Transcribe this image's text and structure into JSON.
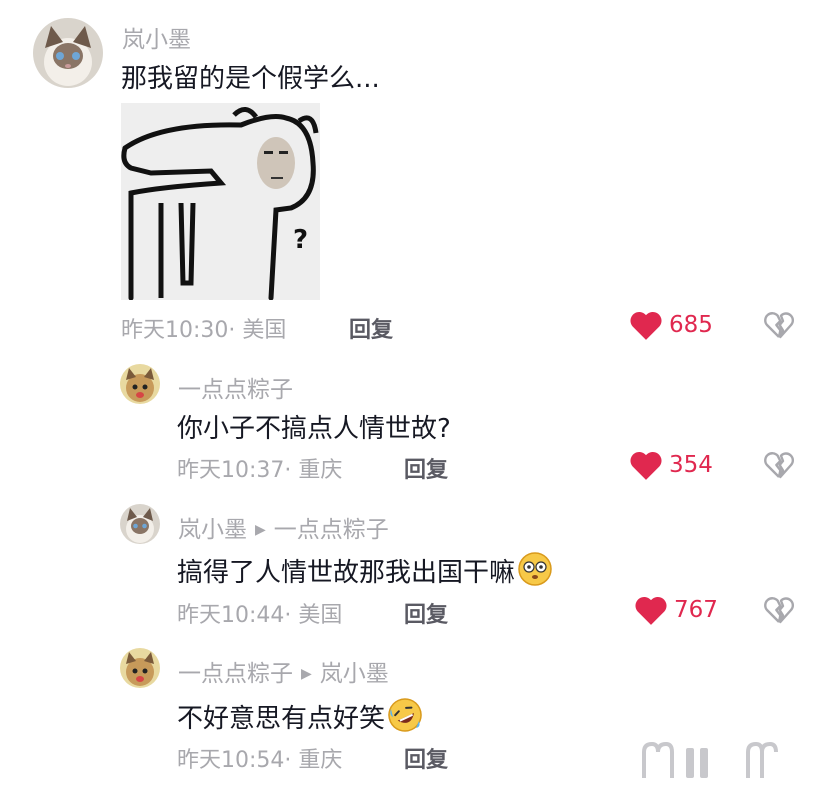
{
  "comments": [
    {
      "username": "岚小墨",
      "text": "那我留的是个假学么...",
      "time": "昨天10:30",
      "location": "· 美国",
      "reply_label": "回复",
      "likes": "685",
      "avatar": "cat-avatar"
    },
    {
      "username": "一点点粽子",
      "text": "你小子不搞点人情世故?",
      "time": "昨天10:37",
      "location": "· 重庆",
      "reply_label": "回复",
      "likes": "354",
      "avatar": "cat-avatar-2"
    },
    {
      "username": "岚小墨",
      "reply_to": "一点点粽子",
      "text": "搞得了人情世故那我出国干嘛",
      "emoji": "flushed-face",
      "time": "昨天10:44",
      "location": "· 美国",
      "reply_label": "回复",
      "likes": "767",
      "avatar": "cat-avatar"
    },
    {
      "username": "一点点粽子",
      "reply_to": "岚小墨",
      "text": "不好意思有点好笑",
      "emoji": "rolling-laughing-face",
      "time": "昨天10:54",
      "location": "· 重庆",
      "reply_label": "回复",
      "avatar": "cat-avatar-2"
    }
  ],
  "sticker": {
    "text": "?",
    "description_icon": "meme-sticker-bear"
  },
  "colors": {
    "like": "#e0284f",
    "meta": "#a8a8ad",
    "text": "#161823"
  }
}
